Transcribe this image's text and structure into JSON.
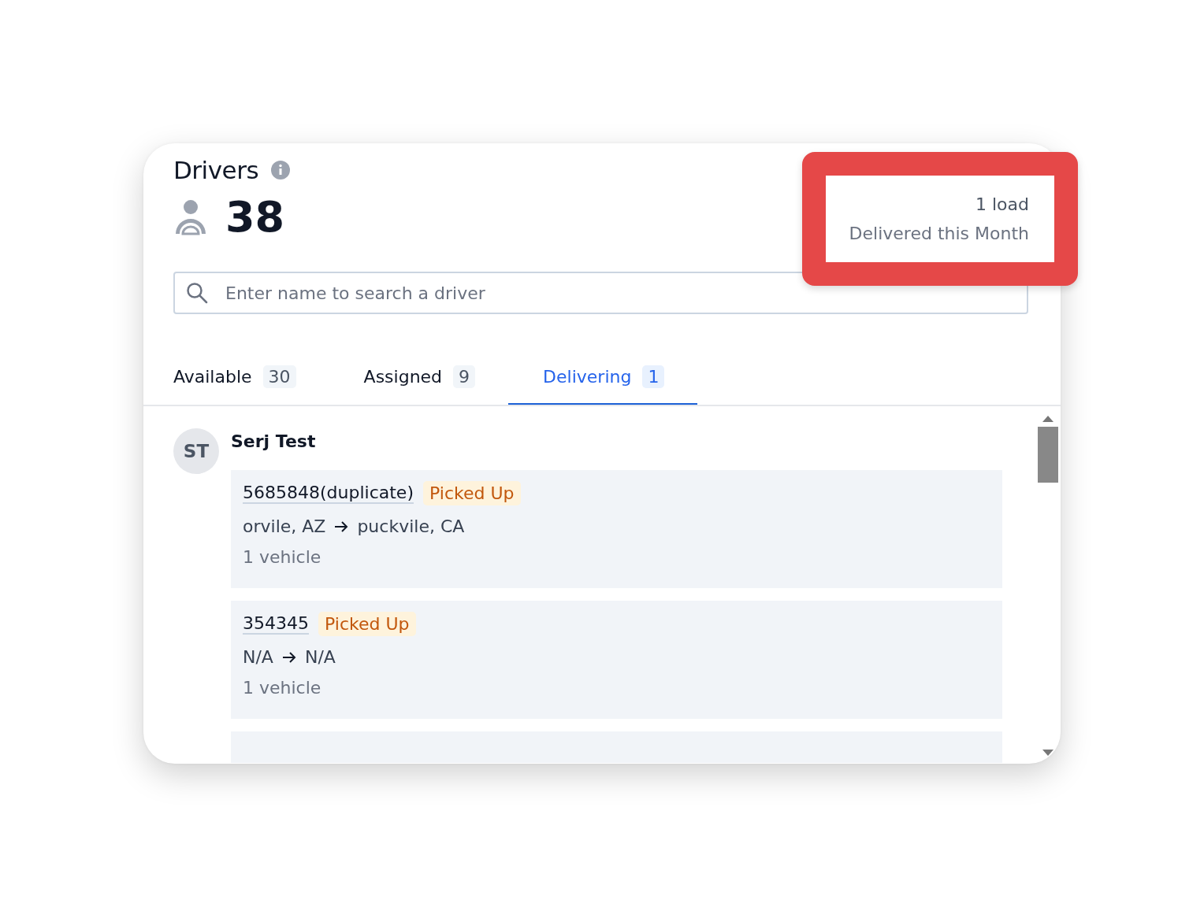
{
  "panel": {
    "title": "Drivers",
    "count": "38"
  },
  "highlight": {
    "value": "1 load",
    "label": "Delivered this Month"
  },
  "search": {
    "placeholder": "Enter name to search a driver"
  },
  "tabs": [
    {
      "label": "Available",
      "count": "30",
      "selected": false
    },
    {
      "label": "Assigned",
      "count": "9",
      "selected": false
    },
    {
      "label": "Delivering",
      "count": "1",
      "selected": true
    }
  ],
  "drivers": [
    {
      "initials": "ST",
      "name": "Serj Test",
      "loads": [
        {
          "id": "5685848(duplicate)",
          "status": "Picked Up",
          "route_from": "orvile, AZ",
          "route_to": "puckvile, CA",
          "vehicles": "1 vehicle"
        },
        {
          "id": "354345",
          "status": "Picked Up",
          "route_from": "N/A",
          "route_to": "N/A",
          "vehicles": "1 vehicle"
        },
        {
          "kind": "partial"
        }
      ]
    }
  ]
}
